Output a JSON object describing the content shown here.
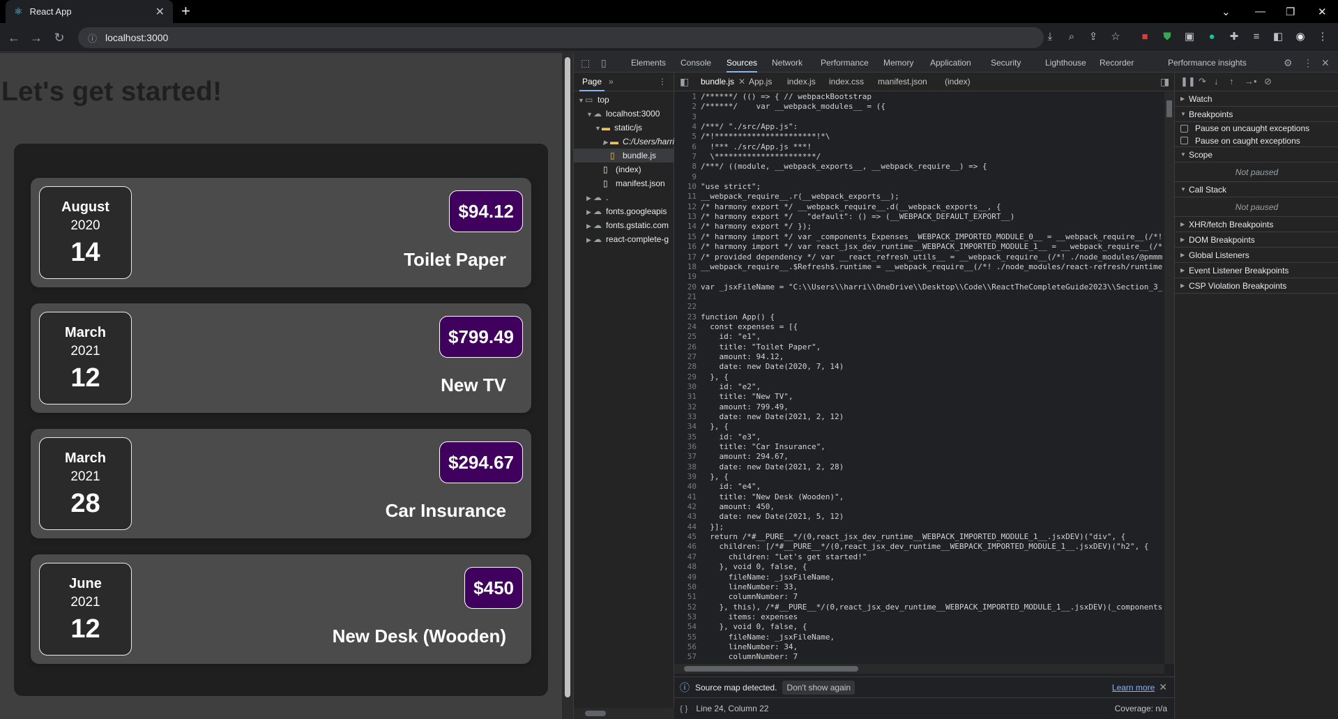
{
  "browser": {
    "tab_title": "React App",
    "url": "localhost:3000"
  },
  "app": {
    "heading": "Let's get started!",
    "expenses": [
      {
        "month": "August",
        "year": "2020",
        "day": "14",
        "amount": "$94.12",
        "title": "Toilet Paper"
      },
      {
        "month": "March",
        "year": "2021",
        "day": "12",
        "amount": "$799.49",
        "title": "New TV"
      },
      {
        "month": "March",
        "year": "2021",
        "day": "28",
        "amount": "$294.67",
        "title": "Car Insurance"
      },
      {
        "month": "June",
        "year": "2021",
        "day": "12",
        "amount": "$450",
        "title": "New Desk (Wooden)"
      }
    ]
  },
  "devtools": {
    "tabs": [
      "Elements",
      "Console",
      "Sources",
      "Network",
      "Performance",
      "Memory",
      "Application",
      "Security",
      "Lighthouse",
      "Recorder",
      "Performance insights"
    ],
    "active_tab": "Sources",
    "navigator": {
      "tab": "Page",
      "tree": [
        {
          "label": "top",
          "icon": "frame"
        },
        {
          "label": "localhost:3000",
          "icon": "cloud"
        },
        {
          "label": "static/js",
          "icon": "folder"
        },
        {
          "label": "C:/Users/harri",
          "icon": "folder"
        },
        {
          "label": "bundle.js",
          "icon": "js"
        },
        {
          "label": "(index)",
          "icon": "file"
        },
        {
          "label": "manifest.json",
          "icon": "file"
        },
        {
          "label": ".",
          "icon": "cloud"
        },
        {
          "label": "fonts.googleapis",
          "icon": "cloud"
        },
        {
          "label": "fonts.gstatic.com",
          "icon": "cloud"
        },
        {
          "label": "react-complete-g",
          "icon": "cloud"
        }
      ]
    },
    "editor_tabs": [
      "bundle.js",
      "App.js",
      "index.js",
      "index.css",
      "manifest.json",
      "(index)"
    ],
    "code_lines": [
      "/******/ (() => { // webpackBootstrap",
      "/******/    var __webpack_modules__ = ({",
      "",
      "/***/ \"./src/App.js\":",
      "/*!**********************!*\\",
      "  !*** ./src/App.js ***!",
      "  \\**********************/",
      "/***/ ((module, __webpack_exports__, __webpack_require__) => {",
      "",
      "\"use strict\";",
      "__webpack_require__.r(__webpack_exports__);",
      "/* harmony export */ __webpack_require__.d(__webpack_exports__, {",
      "/* harmony export */   \"default\": () => (__WEBPACK_DEFAULT_EXPORT__)",
      "/* harmony export */ });",
      "/* harmony import */ var _components_Expenses__WEBPACK_IMPORTED_MODULE_0__ = __webpack_require__(/*!",
      "/* harmony import */ var react_jsx_dev_runtime__WEBPACK_IMPORTED_MODULE_1__ = __webpack_require__(/*",
      "/* provided dependency */ var __react_refresh_utils__ = __webpack_require__(/*! ./node_modules/@pmmm",
      "__webpack_require__.$Refresh$.runtime = __webpack_require__(/*! ./node_modules/react-refresh/runtime",
      "",
      "var _jsxFileName = \"C:\\\\Users\\\\harri\\\\OneDrive\\\\Desktop\\\\Code\\\\ReactTheCompleteGuide2023\\\\Section_3_",
      "",
      "",
      "function App() {",
      "  const expenses = [{",
      "    id: \"e1\",",
      "    title: \"Toilet Paper\",",
      "    amount: 94.12,",
      "    date: new Date(2020, 7, 14)",
      "  }, {",
      "    id: \"e2\",",
      "    title: \"New TV\",",
      "    amount: 799.49,",
      "    date: new Date(2021, 2, 12)",
      "  }, {",
      "    id: \"e3\",",
      "    title: \"Car Insurance\",",
      "    amount: 294.67,",
      "    date: new Date(2021, 2, 28)",
      "  }, {",
      "    id: \"e4\",",
      "    title: \"New Desk (Wooden)\",",
      "    amount: 450,",
      "    date: new Date(2021, 5, 12)",
      "  }];",
      "  return /*#__PURE__*/(0,react_jsx_dev_runtime__WEBPACK_IMPORTED_MODULE_1__.jsxDEV)(\"div\", {",
      "    children: [/*#__PURE__*/(0,react_jsx_dev_runtime__WEBPACK_IMPORTED_MODULE_1__.jsxDEV)(\"h2\", {",
      "      children: \"Let's get started!\"",
      "    }, void 0, false, {",
      "      fileName: _jsxFileName,",
      "      lineNumber: 33,",
      "      columnNumber: 7",
      "    }, this), /*#__PURE__*/(0,react_jsx_dev_runtime__WEBPACK_IMPORTED_MODULE_1__.jsxDEV)(_components",
      "      items: expenses",
      "    }, void 0, false, {",
      "      fileName: _jsxFileName,",
      "      lineNumber: 34,",
      "      columnNumber: 7"
    ],
    "infobar": {
      "message": "Source map detected.",
      "dismiss": "Don't show again",
      "learn_more": "Learn more"
    },
    "status": {
      "position": "Line 24, Column 22",
      "coverage": "Coverage: n/a"
    },
    "debugger": {
      "watch": "Watch",
      "breakpoints": "Breakpoints",
      "pause_uncaught": "Pause on uncaught exceptions",
      "pause_caught": "Pause on caught exceptions",
      "scope": "Scope",
      "not_paused": "Not paused",
      "call_stack": "Call Stack",
      "sections": [
        "XHR/fetch Breakpoints",
        "DOM Breakpoints",
        "Global Listeners",
        "Event Listener Breakpoints",
        "CSP Violation Breakpoints"
      ]
    }
  }
}
